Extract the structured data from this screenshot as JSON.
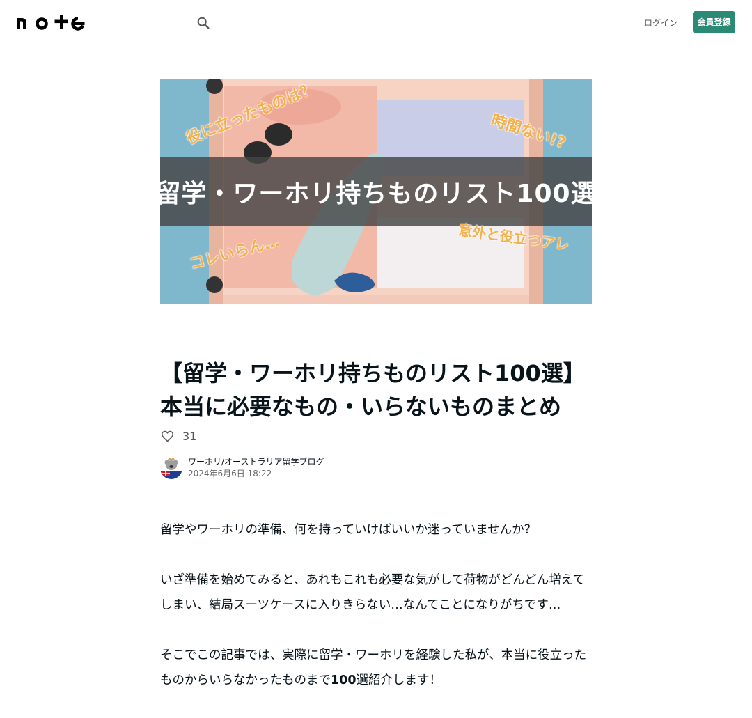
{
  "header": {
    "logo_text": "note",
    "login_label": "ログイン",
    "signup_label": "会員登録",
    "accent_color": "#2a8a75"
  },
  "eyecatch": {
    "banner_title": "留学・ワーホリ持ちものリスト100選",
    "callout_top_left": "役に立ったものは？",
    "callout_top_right": "時間ない!?",
    "callout_bottom_left": "コレいらん…",
    "callout_bottom_right": "意外と役立つアレ"
  },
  "article": {
    "title": "【留学・ワーホリ持ちものリスト100選】本当に必要なもの・いらないものまとめ",
    "like_count": "31",
    "author_name": "ワーホリ/オーストラリア留学ブログ",
    "post_date": "2024年6月6日 18:22",
    "paragraphs": [
      "留学やワーホリの準備、何を持っていけばいいか迷っていませんか？",
      "いざ準備を始めてみると、あれもこれも必要な気がして荷物がどんどん増えてしまい、結局スーツケースに入りきらない…なんてことになりがちです…"
    ],
    "paragraph3_text": "そこでこの記事では、実際に留学・ワーホリを経験した私が、本当に役立ったものからいらなかったものまで",
    "paragraph3_bold": "100",
    "paragraph3_tail": "選紹介します！"
  }
}
